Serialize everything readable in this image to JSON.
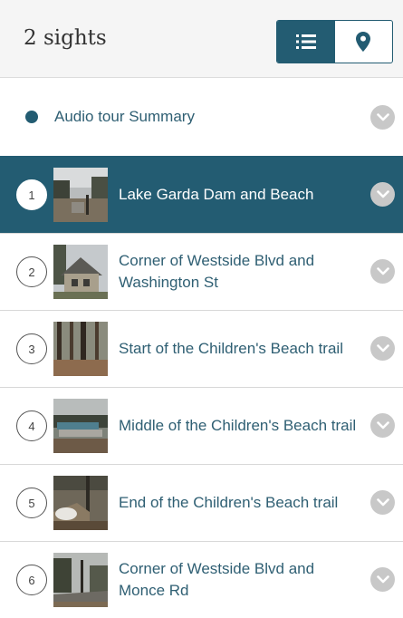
{
  "header": {
    "title": "2 sights",
    "toggle": {
      "list_icon": "list-icon",
      "map_icon": "map-pin-icon",
      "active": "list"
    }
  },
  "summary": {
    "label": "Audio tour Summary",
    "chevron_icon": "chevron-down-icon"
  },
  "sights": [
    {
      "number": "1",
      "title": "Lake Garda Dam and Beach",
      "active": true,
      "thumb": "photo-dam-beach"
    },
    {
      "number": "2",
      "title": "Corner of Westside Blvd and Washington St",
      "active": false,
      "thumb": "photo-house"
    },
    {
      "number": "3",
      "title": "Start of the Children's Beach trail",
      "active": false,
      "thumb": "photo-forest-trail"
    },
    {
      "number": "4",
      "title": "Middle of the Children's Beach trail",
      "active": false,
      "thumb": "photo-boats"
    },
    {
      "number": "5",
      "title": "End of the Children's Beach trail",
      "active": false,
      "thumb": "photo-trail-end"
    },
    {
      "number": "6",
      "title": "Corner of Westside Blvd and Monce Rd",
      "active": false,
      "thumb": "photo-road-corner"
    }
  ],
  "colors": {
    "accent": "#235c72",
    "chevron_bg": "#c8c8c8",
    "header_bg": "#f5f5f5"
  }
}
